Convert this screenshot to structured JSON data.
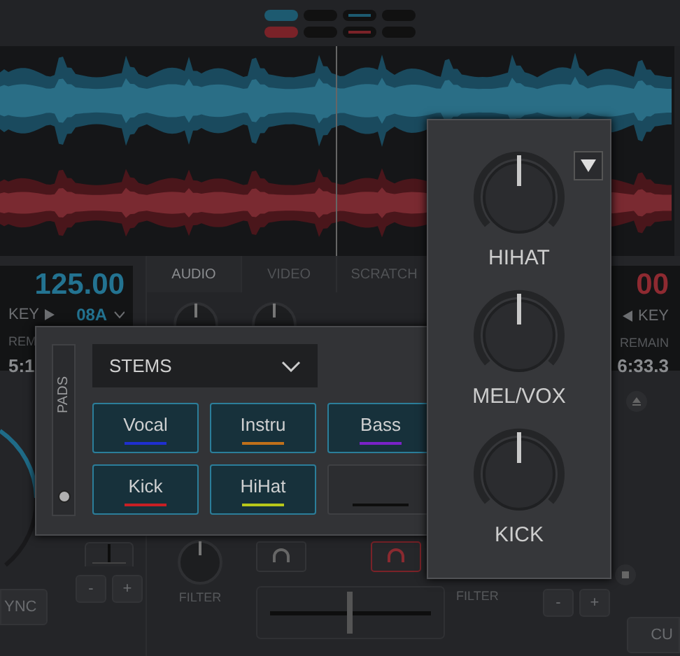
{
  "mixer_tabs": [
    {
      "label": "AUDIO",
      "selected": true
    },
    {
      "label": "VIDEO",
      "selected": false
    },
    {
      "label": "SCRATCH",
      "selected": false
    }
  ],
  "deck_left": {
    "bpm": "125.00",
    "key_label": "KEY",
    "key": "08A",
    "remain_label": "REM",
    "remain": "5:1",
    "sync": "YNC",
    "pitch_buttons": [
      "-",
      "+"
    ],
    "filter": "FILTER"
  },
  "deck_right": {
    "bpm": "00",
    "key_label": "KEY",
    "remain_label": "REMAIN",
    "remain": "6:33.3",
    "cue": "CU",
    "pitch_buttons": [
      "-",
      "+"
    ],
    "filter": "FILTER"
  },
  "pads_panel": {
    "side_label": "PADS",
    "mode": "STEMS",
    "pads": [
      {
        "kind": "pad",
        "label": "Vocal",
        "color": "#1f2fd0"
      },
      {
        "kind": "pad",
        "label": "Instru",
        "color": "#c0701a"
      },
      {
        "kind": "pad",
        "label": "Bass",
        "color": "#7a22c8"
      },
      {
        "kind": "pad",
        "label": "Kick",
        "color": "#c81f24"
      },
      {
        "kind": "pad",
        "label": "HiHat",
        "color": "#b8c81a"
      },
      {
        "kind": "empty",
        "color": "#0e0e0e"
      }
    ]
  },
  "stems_panel": {
    "knobs": [
      {
        "label": "HIHAT",
        "level": 0.5
      },
      {
        "label": "MEL/VOX",
        "level": 0.5
      },
      {
        "label": "KICK",
        "level": 0.5
      }
    ]
  }
}
